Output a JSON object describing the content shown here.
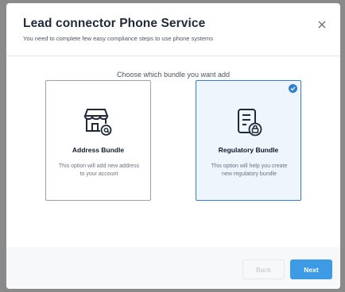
{
  "modal": {
    "title": "Lead connector Phone Service",
    "subtitle": "You need to complete few easy compliance steps to use phone systems",
    "close_icon": "close-icon"
  },
  "prompt": "Choose which bundle you want add",
  "cards": [
    {
      "icon": "storefront-at-icon",
      "title": "Address Bundle",
      "description": "This option will add new address to your account",
      "selected": false
    },
    {
      "icon": "document-lock-icon",
      "title": "Regulatory Bundle",
      "description": "This option will help you create new regulatory bundle",
      "selected": true
    }
  ],
  "footer": {
    "back_label": "Back",
    "next_label": "Next"
  },
  "colors": {
    "accent": "#3d9be5",
    "selected_border": "#2f80d1",
    "selected_bg": "#eef5fd"
  }
}
